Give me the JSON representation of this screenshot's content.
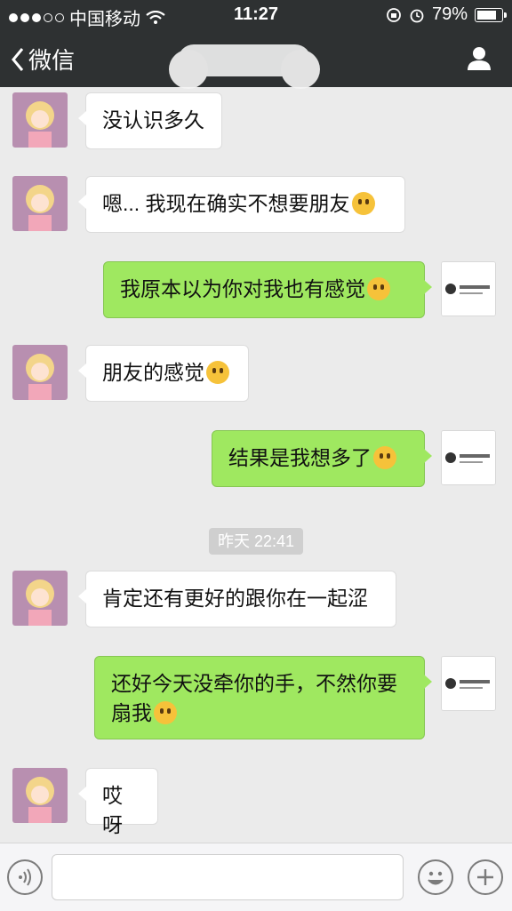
{
  "status_bar": {
    "carrier": "中国移动",
    "time": "11:27",
    "battery": "79%",
    "battery_level": 0.79
  },
  "navbar": {
    "back_label": "微信"
  },
  "messages": [
    {
      "side": "in",
      "text": "没认识多久",
      "emoji": ""
    },
    {
      "side": "in",
      "text": "嗯... 我现在确实不想要朋友",
      "emoji": "worried-emoji"
    },
    {
      "side": "out",
      "text": "我原本以为你对我也有感觉",
      "emoji": "thinking-emoji"
    },
    {
      "side": "in",
      "text": "朋友的感觉",
      "emoji": "flushed-emoji"
    },
    {
      "side": "out",
      "text": "结果是我想多了",
      "emoji": "thinking-emoji"
    },
    {
      "side": "in",
      "text": "肯定还有更好的跟你在一起涩",
      "emoji": ""
    },
    {
      "side": "out",
      "text": "还好今天没牵你的手，不然你要扇我",
      "emoji": "grin-emoji"
    },
    {
      "side": "in",
      "text": "哎呀",
      "emoji": ""
    }
  ],
  "timestamp": "昨天 22:41",
  "input": {
    "value": ""
  },
  "colors": {
    "bar": "#2e3132",
    "outgoing_bubble": "#9fe860",
    "incoming_bubble": "#ffffff",
    "background": "#ebebeb"
  }
}
